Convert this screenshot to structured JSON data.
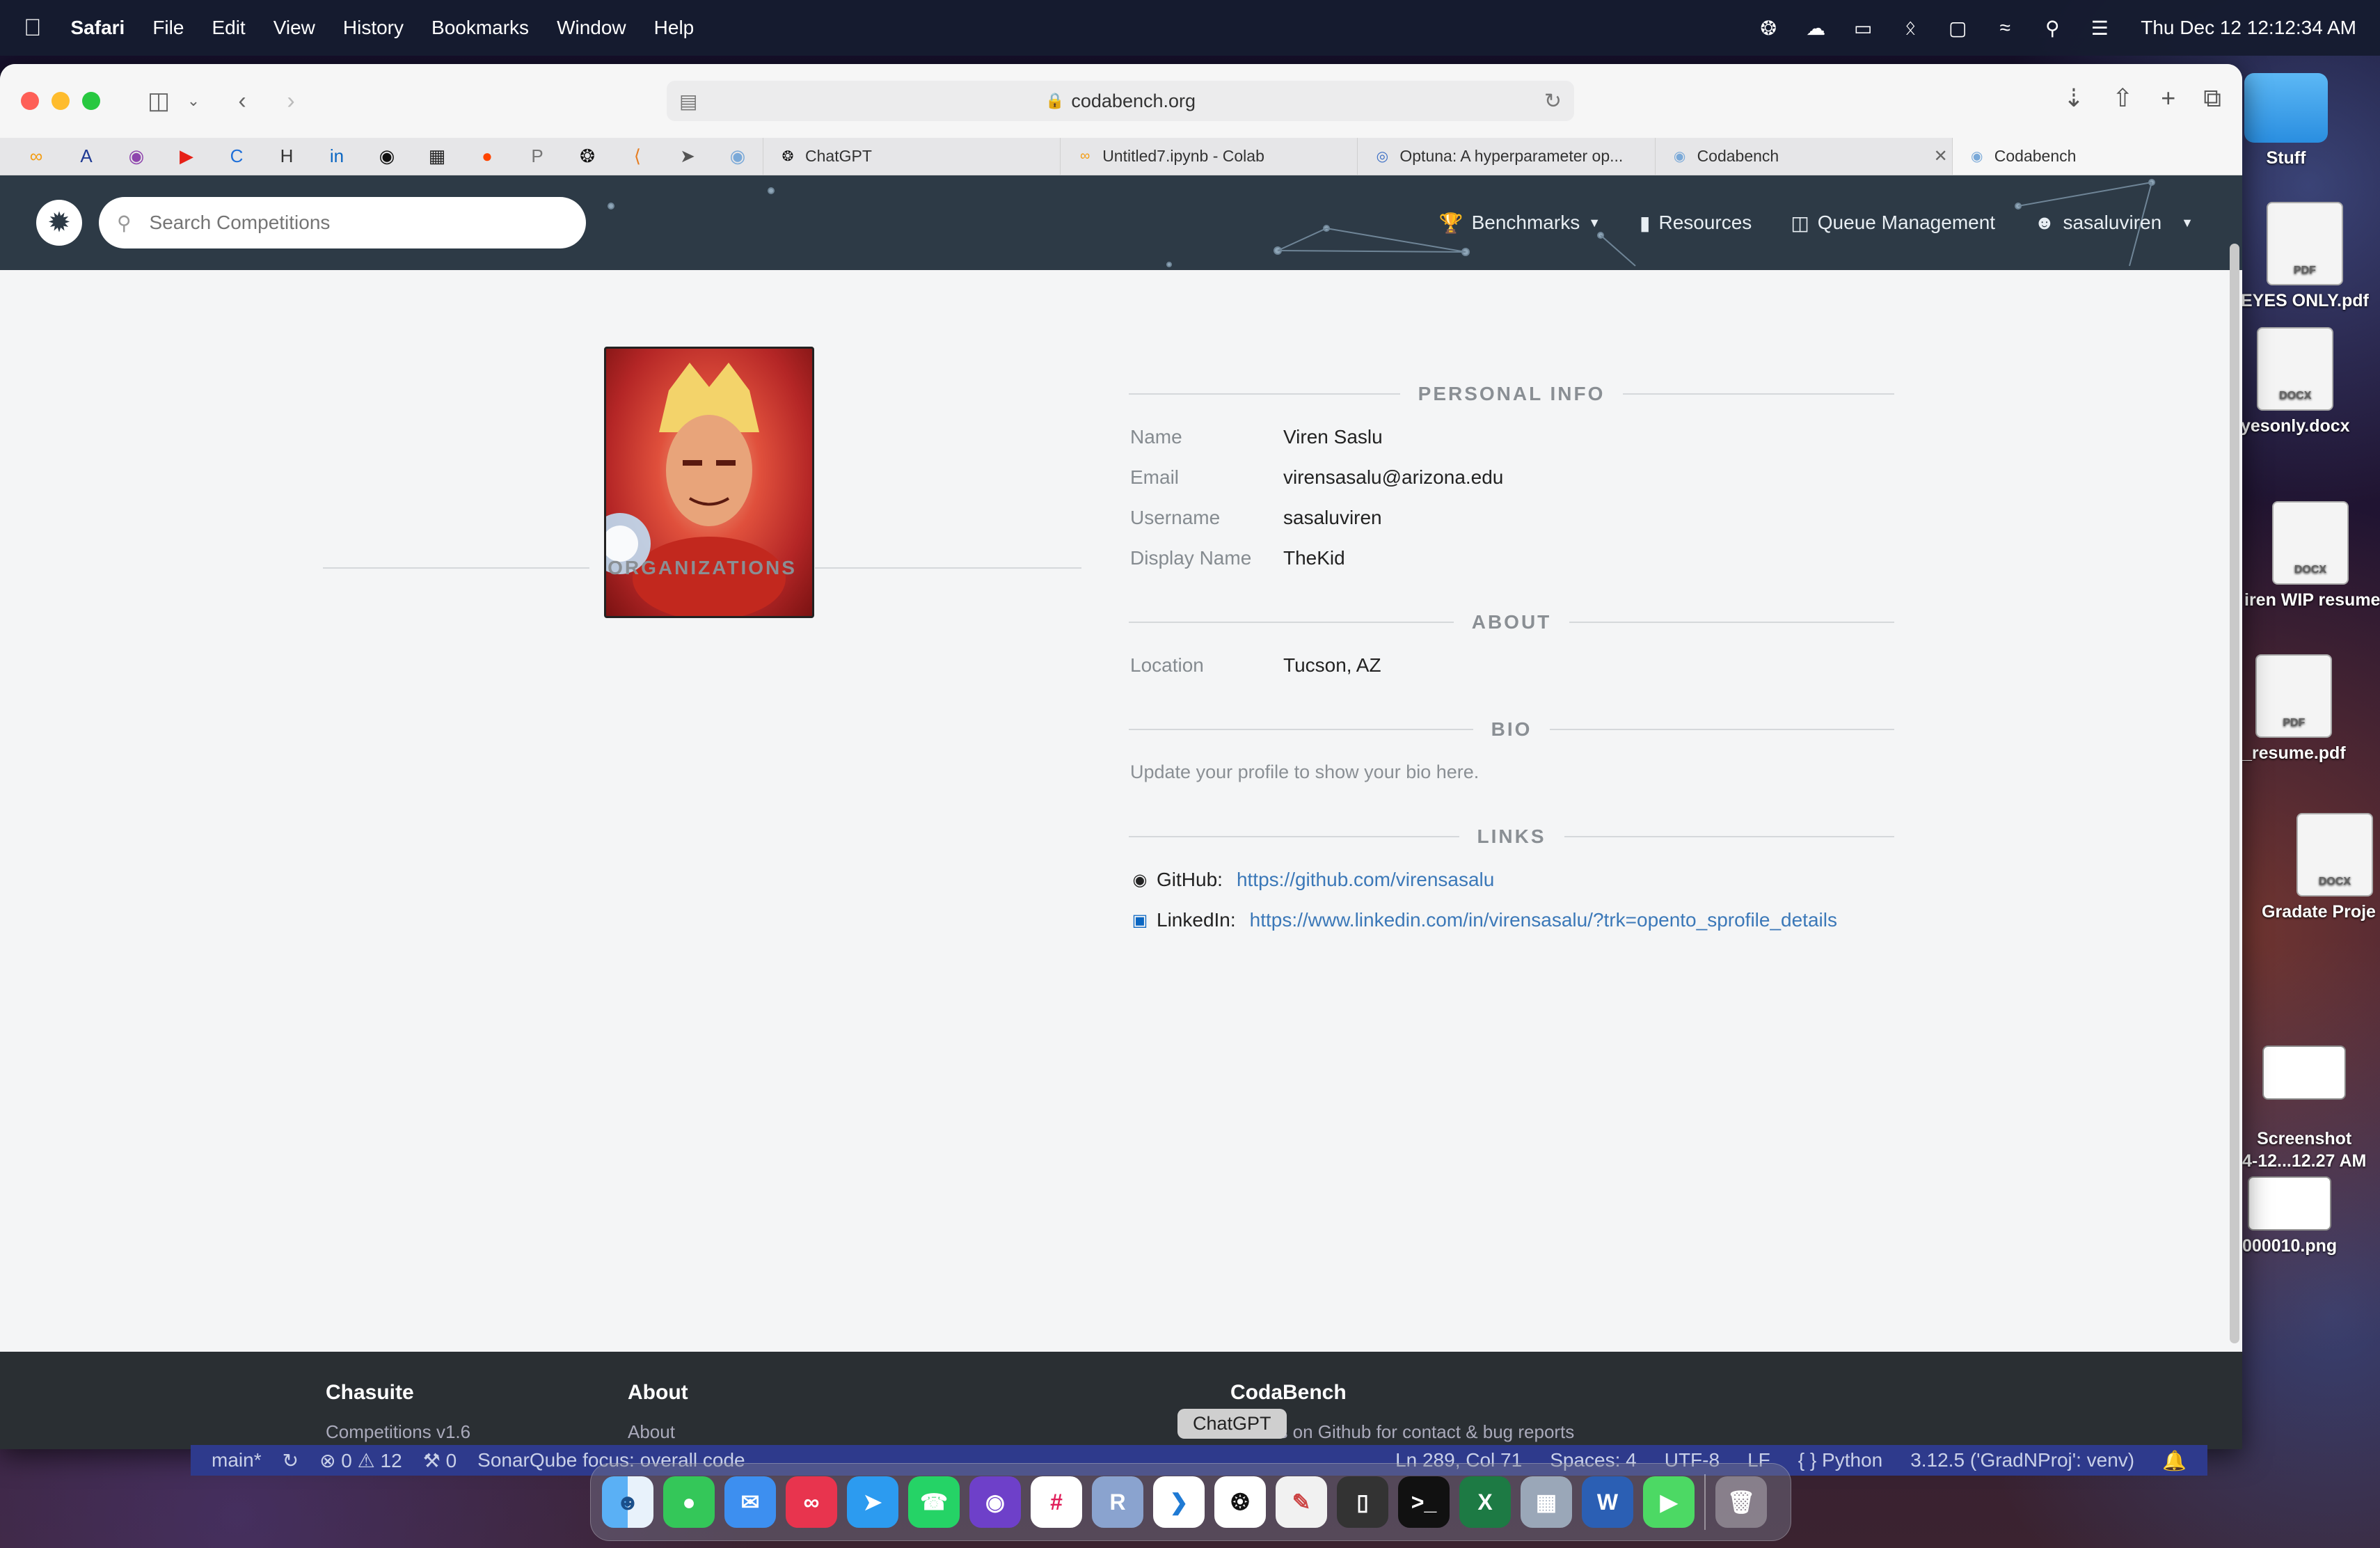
{
  "menubar": {
    "app_name": "Safari",
    "items": [
      "File",
      "Edit",
      "View",
      "History",
      "Bookmarks",
      "Window",
      "Help"
    ],
    "clock": "Thu Dec 12  12:12:34 AM"
  },
  "browser": {
    "url": "codabench.org",
    "tabs": [
      {
        "label": "ChatGPT"
      },
      {
        "label": "Untitled7.ipynb - Colab"
      },
      {
        "label": "Optuna: A hyperparameter op..."
      },
      {
        "label": "Codabench"
      },
      {
        "label": "Codabench"
      }
    ]
  },
  "site": {
    "search_placeholder": "Search Competitions",
    "nav": {
      "benchmarks": "Benchmarks",
      "resources": "Resources",
      "queue": "Queue Management",
      "user": "sasaluviren"
    }
  },
  "profile": {
    "organizations_title": "ORGANIZATIONS",
    "personal_info_title": "PERSONAL INFO",
    "fields": {
      "name_label": "Name",
      "name_value": "Viren Saslu",
      "email_label": "Email",
      "email_value": "virensasalu@arizona.edu",
      "username_label": "Username",
      "username_value": "sasaluviren",
      "display_label": "Display Name",
      "display_value": "TheKid"
    },
    "about_title": "ABOUT",
    "location_label": "Location",
    "location_value": "Tucson, AZ",
    "bio_title": "BIO",
    "bio_text": "Update your profile to show your bio here.",
    "links_title": "LINKS",
    "github_label": "GitHub:",
    "github_url": "https://github.com/virensasalu",
    "linkedin_label": "LinkedIn:",
    "linkedin_url": "https://www.linkedin.com/in/virensasalu/?trk=opento_sprofile_details"
  },
  "footer": {
    "col1_title": "Chasuite",
    "col1_sub": "Competitions v1.6",
    "col2_title": "About",
    "col2_sub": "About",
    "col3_title": "CodaBench",
    "col3_sub": "Join us on Github for contact & bug reports"
  },
  "statusbar": {
    "branch": "main*",
    "problems": "⊗ 0 ⚠ 12",
    "ports": "⚒ 0",
    "sonar": "SonarQube focus: overall code",
    "position": "Ln 289, Col 71",
    "spaces": "Spaces: 4",
    "encoding": "UTF-8",
    "eol": "LF",
    "language": "{ } Python",
    "interpreter": "3.12.5 ('GradNProj': venv)"
  },
  "tooltip": "ChatGPT",
  "desktop": {
    "items": [
      "Stuff",
      "EYES ONLY.pdf",
      "yesonly.docx",
      "iren WIP resume",
      "_resume.pdf",
      "Gradate Proje",
      "Screenshot\n4-12...12.27 AM",
      "000010.png"
    ]
  },
  "colors": {
    "nav_bg": "#2d3a46",
    "link": "#3b78b8",
    "accent_status": "#2e3a8c"
  }
}
